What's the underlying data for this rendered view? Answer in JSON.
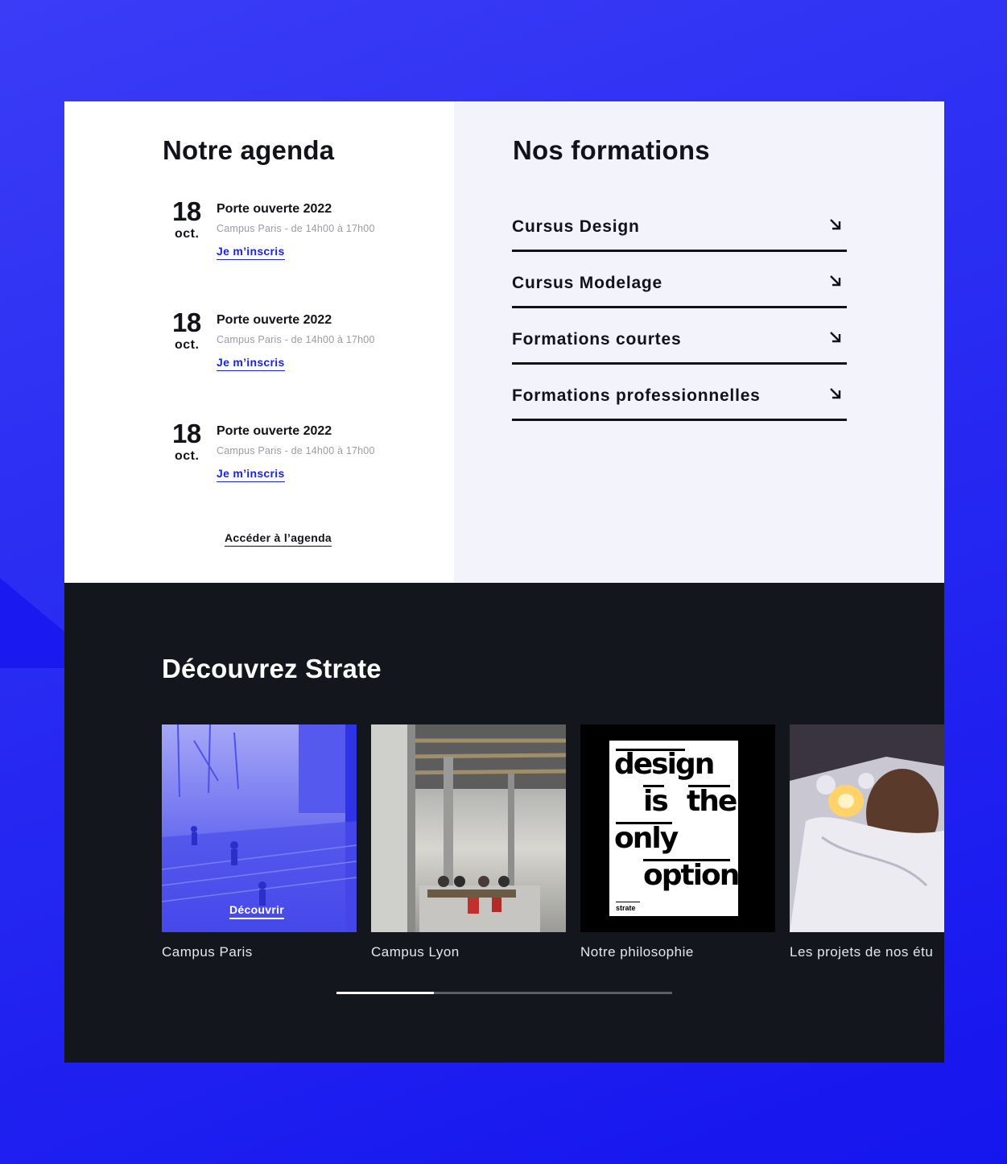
{
  "agenda": {
    "title": "Notre agenda",
    "events": [
      {
        "day": "18",
        "month": "oct.",
        "name": "Porte ouverte 2022",
        "meta": "Campus Paris - de 14h00 à 17h00",
        "cta": "Je m’inscris"
      },
      {
        "day": "18",
        "month": "oct.",
        "name": "Porte ouverte 2022",
        "meta": "Campus Paris - de 14h00 à 17h00",
        "cta": "Je m’inscris"
      },
      {
        "day": "18",
        "month": "oct.",
        "name": "Porte ouverte 2022",
        "meta": "Campus Paris - de 14h00 à 17h00",
        "cta": "Je m’inscris"
      }
    ],
    "link": "Accéder à l’agenda"
  },
  "formations": {
    "title": "Nos formations",
    "items": [
      {
        "label": "Cursus Design",
        "icon": "arrow-down-right-icon"
      },
      {
        "label": "Cursus Modelage",
        "icon": "arrow-down-right-icon"
      },
      {
        "label": "Formations courtes",
        "icon": "arrow-down-right-icon"
      },
      {
        "label": "Formations professionnelles",
        "icon": "arrow-down-right-icon"
      }
    ]
  },
  "discover": {
    "title": "Découvrez Strate",
    "cards": [
      {
        "caption": "Campus Paris",
        "overlay": "Découvrir"
      },
      {
        "caption": "Campus Lyon"
      },
      {
        "caption": "Notre philosophie",
        "poster": [
          "design",
          "is",
          "the",
          "only",
          "option"
        ],
        "poster_footer": "strate"
      },
      {
        "caption": "Les projets de nos étu"
      }
    ],
    "progress": 0.29
  },
  "colors": {
    "accent": "#1d22e0",
    "dark": "#13161d",
    "background": "#2a2df2"
  }
}
